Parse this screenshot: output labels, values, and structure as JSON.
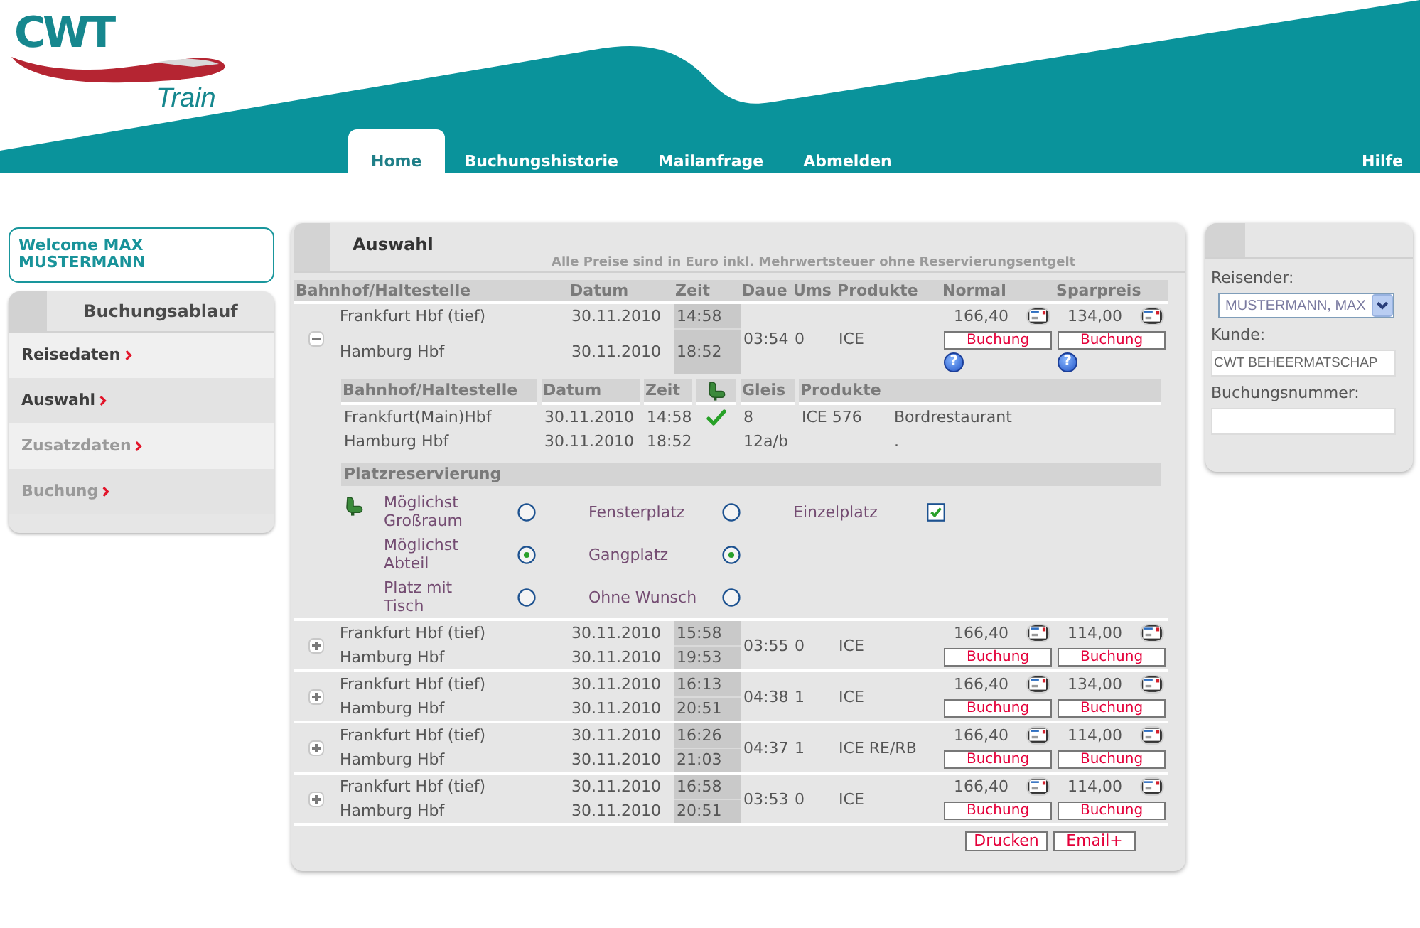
{
  "header": {
    "logo": {
      "wordmark": "CWT",
      "tagline": "Train"
    },
    "nav": [
      {
        "label": "Home",
        "selected": true
      },
      {
        "label": "Buchungshistorie",
        "selected": false
      },
      {
        "label": "Mailanfrage",
        "selected": false
      },
      {
        "label": "Abmelden",
        "selected": false
      }
    ],
    "help_link": "Hilfe"
  },
  "welcome": "Welcome MAX MUSTERMANN",
  "booking_steps": {
    "title": "Buchungsablauf",
    "items": [
      {
        "label": "Reisedaten",
        "disabled": false
      },
      {
        "label": "Auswahl",
        "disabled": false
      },
      {
        "label": "Zusatzdaten",
        "disabled": true
      },
      {
        "label": "Buchung",
        "disabled": true
      }
    ]
  },
  "selection": {
    "title": "Auswahl",
    "note": "Alle Preise sind in Euro inkl. Mehrwertsteuer ohne Reservierungsentgelt",
    "columns": [
      "Bahnhof/Haltestelle",
      "Datum",
      "Zeit",
      "Daue",
      "Ums",
      "Produkte",
      "Normal",
      "Sparpreis"
    ],
    "connections": [
      {
        "expanded": true,
        "stops": [
          {
            "station": "Frankfurt Hbf (tief)",
            "date": "30.11.2010",
            "time": "14:58"
          },
          {
            "station": "Hamburg Hbf",
            "date": "30.11.2010",
            "time": "18:52"
          }
        ],
        "duration": "03:54",
        "changes": "0",
        "products": "ICE",
        "fares": [
          {
            "price": "166,40",
            "button": "Buchung",
            "help": "?"
          },
          {
            "price": "134,00",
            "button": "Buchung",
            "help": "?"
          }
        ],
        "details": {
          "columns": [
            "Bahnhof/Haltestelle",
            "Datum",
            "Zeit",
            "Gleis",
            "Produkte"
          ],
          "stops": [
            {
              "station": "Frankfurt(Main)Hbf",
              "date": "30.11.2010",
              "time": "14:58",
              "reservable": true,
              "platform": "8",
              "train": "ICE 576",
              "service": "Bordrestaurant"
            },
            {
              "station": "Hamburg Hbf",
              "date": "30.11.2010",
              "time": "18:52",
              "reservable": false,
              "platform": "12a/b",
              "service": "."
            }
          ],
          "reservation": {
            "title": "Platzreservierung",
            "rows": [
              {
                "options": [
                  {
                    "kind": "radio",
                    "label": "Möglichst Großraum",
                    "selected": false
                  },
                  {
                    "kind": "radio",
                    "label": "Fensterplatz",
                    "selected": false
                  },
                  {
                    "kind": "checkbox",
                    "label": "Einzelplatz",
                    "checked": true
                  }
                ]
              },
              {
                "options": [
                  {
                    "kind": "radio",
                    "label": "Möglichst Abteil",
                    "selected": true
                  },
                  {
                    "kind": "radio",
                    "label": "Gangplatz",
                    "selected": true
                  }
                ]
              },
              {
                "options": [
                  {
                    "kind": "radio",
                    "label": "Platz mit Tisch",
                    "selected": false
                  },
                  {
                    "kind": "radio",
                    "label": "Ohne Wunsch",
                    "selected": false
                  }
                ]
              }
            ]
          }
        }
      },
      {
        "expanded": false,
        "stops": [
          {
            "station": "Frankfurt Hbf (tief)",
            "date": "30.11.2010",
            "time": "15:58"
          },
          {
            "station": "Hamburg Hbf",
            "date": "30.11.2010",
            "time": "19:53"
          }
        ],
        "duration": "03:55",
        "changes": "0",
        "products": "ICE",
        "fares": [
          {
            "price": "166,40",
            "button": "Buchung"
          },
          {
            "price": "114,00",
            "button": "Buchung"
          }
        ]
      },
      {
        "expanded": false,
        "stops": [
          {
            "station": "Frankfurt Hbf (tief)",
            "date": "30.11.2010",
            "time": "16:13"
          },
          {
            "station": "Hamburg Hbf",
            "date": "30.11.2010",
            "time": "20:51"
          }
        ],
        "duration": "04:38",
        "changes": "1",
        "products": "ICE",
        "fares": [
          {
            "price": "166,40",
            "button": "Buchung"
          },
          {
            "price": "134,00",
            "button": "Buchung"
          }
        ]
      },
      {
        "expanded": false,
        "stops": [
          {
            "station": "Frankfurt Hbf (tief)",
            "date": "30.11.2010",
            "time": "16:26"
          },
          {
            "station": "Hamburg Hbf",
            "date": "30.11.2010",
            "time": "21:03"
          }
        ],
        "duration": "04:37",
        "changes": "1",
        "products": "ICE RE/RB",
        "fares": [
          {
            "price": "166,40",
            "button": "Buchung"
          },
          {
            "price": "114,00",
            "button": "Buchung"
          }
        ]
      },
      {
        "expanded": false,
        "stops": [
          {
            "station": "Frankfurt Hbf (tief)",
            "date": "30.11.2010",
            "time": "16:58"
          },
          {
            "station": "Hamburg Hbf",
            "date": "30.11.2010",
            "time": "20:51"
          }
        ],
        "duration": "03:53",
        "changes": "0",
        "products": "ICE",
        "fares": [
          {
            "price": "166,40",
            "button": "Buchung"
          },
          {
            "price": "114,00",
            "button": "Buchung"
          }
        ]
      }
    ],
    "actions": [
      "Drucken",
      "Email+"
    ]
  },
  "search_panel": {
    "fields": [
      {
        "kind": "select",
        "label": "Reisender:",
        "value": "MUSTERMANN, MAX"
      },
      {
        "kind": "text",
        "label": "Kunde:",
        "value": "CWT BEHEERMATSCHAP"
      },
      {
        "kind": "text",
        "label": "Buchungsnummer:"
      }
    ]
  }
}
